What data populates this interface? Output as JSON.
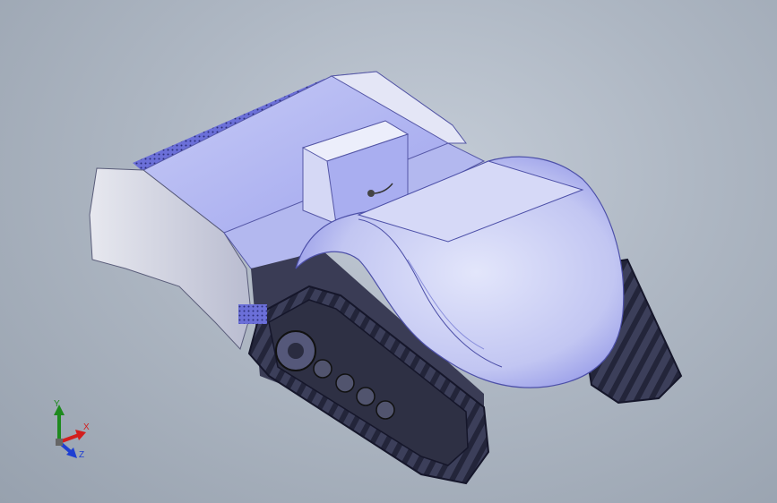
{
  "viewport": {
    "background_top": "#c4ccd7",
    "background_bottom": "#97a1ae",
    "model": {
      "name": "tracked-robot-chassis",
      "body_color": "#bcc2ee",
      "shadow_color": "#6b6fe0",
      "track_color": "#2e3044",
      "frame_color": "#3a3c55"
    }
  },
  "triad": {
    "x_label": "X",
    "y_label": "Y",
    "z_label": "Z",
    "x_color": "#d21e1e",
    "y_color": "#1e8a1e",
    "z_color": "#1e3fd2"
  }
}
